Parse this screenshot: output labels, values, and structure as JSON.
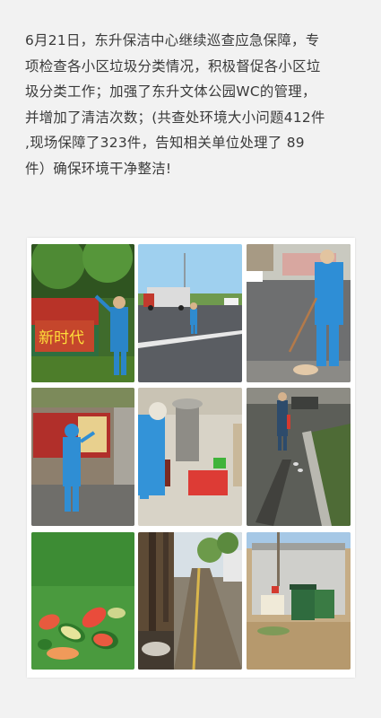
{
  "article": {
    "lines": [
      "6月21日，东升保洁中心继续巡查应急保障，专",
      "项检查各小区垃圾分类情况，积极督促各小区垃",
      "圾分类工作；加强了东升文体公园WC的管理，",
      "并增加了清洁次数；(共查处环境大小问题412件",
      ",现场保障了323件，告知相关单位处理了 89",
      "件）确保环境干净整洁!"
    ],
    "sign_text": "新时代"
  },
  "photos": [
    {
      "name": "worker-cleaning-wall-photo"
    },
    {
      "name": "street-truck-photo"
    },
    {
      "name": "sweeping-road-photo"
    },
    {
      "name": "worker-by-billboard-photo"
    },
    {
      "name": "trash-bin-cleaning-photo"
    },
    {
      "name": "roadside-litter-photo"
    },
    {
      "name": "watermelon-rind-photo"
    },
    {
      "name": "sidewalk-trees-photo"
    },
    {
      "name": "garbage-bins-photo"
    }
  ]
}
